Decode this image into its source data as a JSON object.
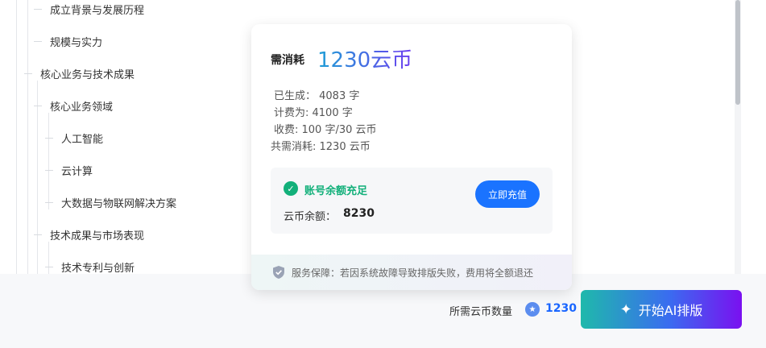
{
  "outline": {
    "items": [
      {
        "label": "成立背景与发展历程",
        "level": 2
      },
      {
        "label": "规模与实力",
        "level": 2
      },
      {
        "label": "核心业务与技术成果",
        "level": 1
      },
      {
        "label": "核心业务领域",
        "level": 2
      },
      {
        "label": "人工智能",
        "level": 3
      },
      {
        "label": "云计算",
        "level": 3
      },
      {
        "label": "大数据与物联网解决方案",
        "level": 3
      },
      {
        "label": "技术成果与市场表现",
        "level": 2
      },
      {
        "label": "技术专利与创新",
        "level": 3
      }
    ]
  },
  "popup": {
    "cost_label": "需消耗",
    "cost_value": "1230云币",
    "generated": "已生成： 4083 字",
    "billed": "计费为: 4100 字",
    "rate": "收费: 100 字/30 云币",
    "total": "共需消耗: 1230 云币",
    "balance_ok": "账号余额充足",
    "balance_label": "云币余额：",
    "balance_value": "8230",
    "recharge_label": "立即充值",
    "guarantee": "服务保障：若因系统故障导致排版失败，费用将全额退还"
  },
  "footer": {
    "need_label": "所需云币数量",
    "need_value": "1230",
    "start_label": "开始AI排版"
  },
  "colors": {
    "accent": "#1a73ff",
    "success": "#12b07a",
    "gradient_start": "#1fb9ab",
    "gradient_end": "#7a10f0"
  }
}
